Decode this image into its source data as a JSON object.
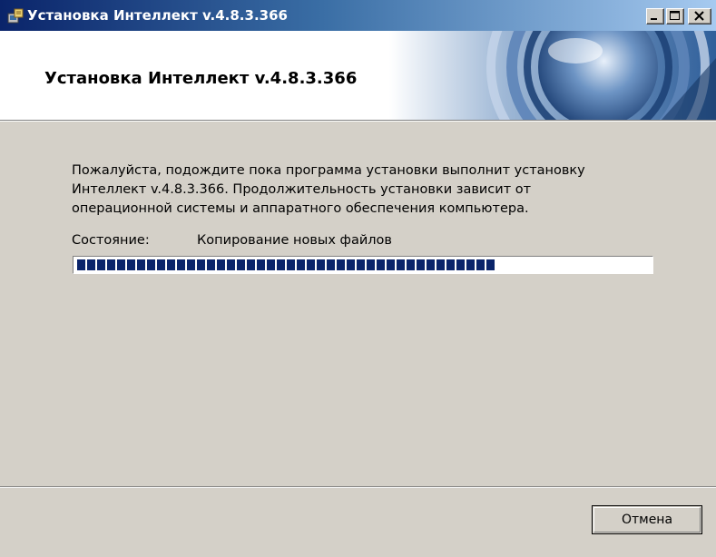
{
  "window": {
    "title": "Установка Интеллект v.4.8.3.366",
    "icon": "installer-icon"
  },
  "titlebar_buttons": {
    "minimize": "minimize-icon",
    "maximize": "maximize-icon",
    "close": "close-icon"
  },
  "header": {
    "heading": "Установка Интеллект v.4.8.3.366"
  },
  "main": {
    "description_lines": [
      "Пожалуйста, подождите пока программа установки выполнит установку",
      "Интеллект v.4.8.3.366. Продолжительность установки зависит от",
      "операционной системы и аппаратного обеспечения компьютера."
    ],
    "status_label": "Состояние:",
    "status_value": "Копирование новых файлов",
    "progress_fraction": 0.75
  },
  "footer": {
    "cancel_label": "Отмена"
  },
  "colors": {
    "progress_fill": "#0a246a",
    "window_bg": "#d4d0c8",
    "title_gradient_start": "#0a246a",
    "title_gradient_end": "#a6caf0"
  }
}
